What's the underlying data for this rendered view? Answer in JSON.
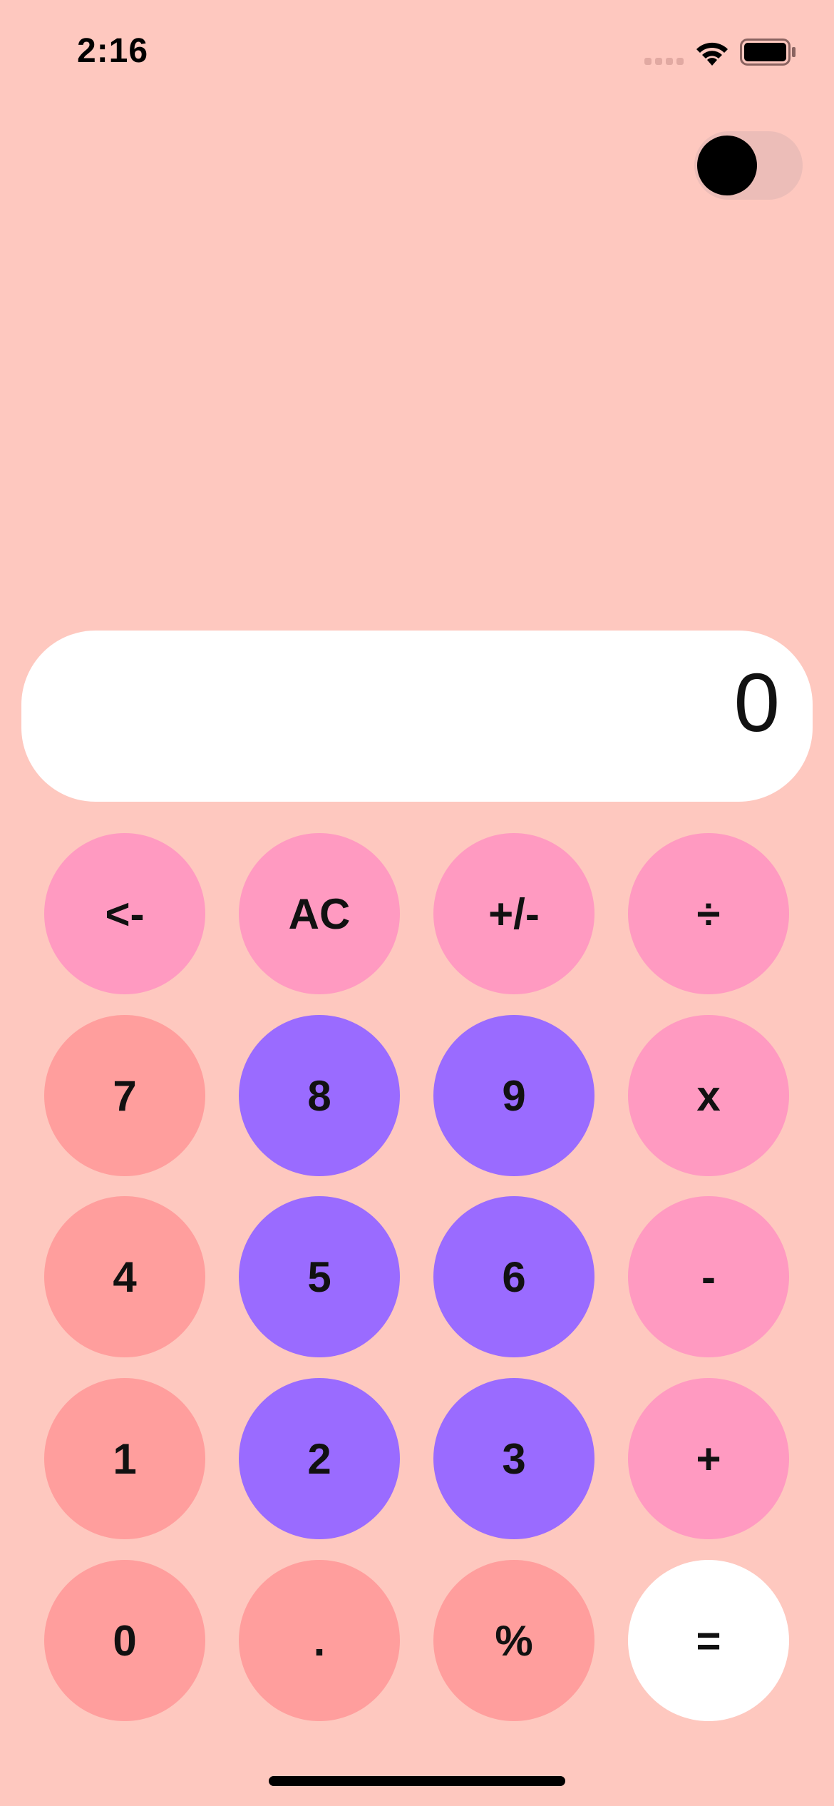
{
  "status_bar": {
    "time": "2:16",
    "icons": [
      "signal-icon",
      "wifi-icon",
      "battery-icon"
    ]
  },
  "theme_toggle": {
    "state": "off"
  },
  "display": {
    "value": "0"
  },
  "keypad": {
    "row1": [
      "<-",
      "AC",
      "+/-",
      "÷"
    ],
    "row2": [
      "7",
      "8",
      "9",
      "x"
    ],
    "row3": [
      "4",
      "5",
      "6",
      "-"
    ],
    "row4": [
      "1",
      "2",
      "3",
      "+"
    ],
    "row5": [
      "0",
      ".",
      "%",
      "="
    ]
  },
  "colors": {
    "background": "#fec8bf",
    "operator_key": "#ff9ac1",
    "digit_key_coral": "#ff9e9d",
    "digit_key_purple": "#9a6bff",
    "equals_key": "#ffffff",
    "display_background": "#ffffff",
    "toggle_track": "#ecbdb8",
    "toggle_knob": "#000000"
  }
}
